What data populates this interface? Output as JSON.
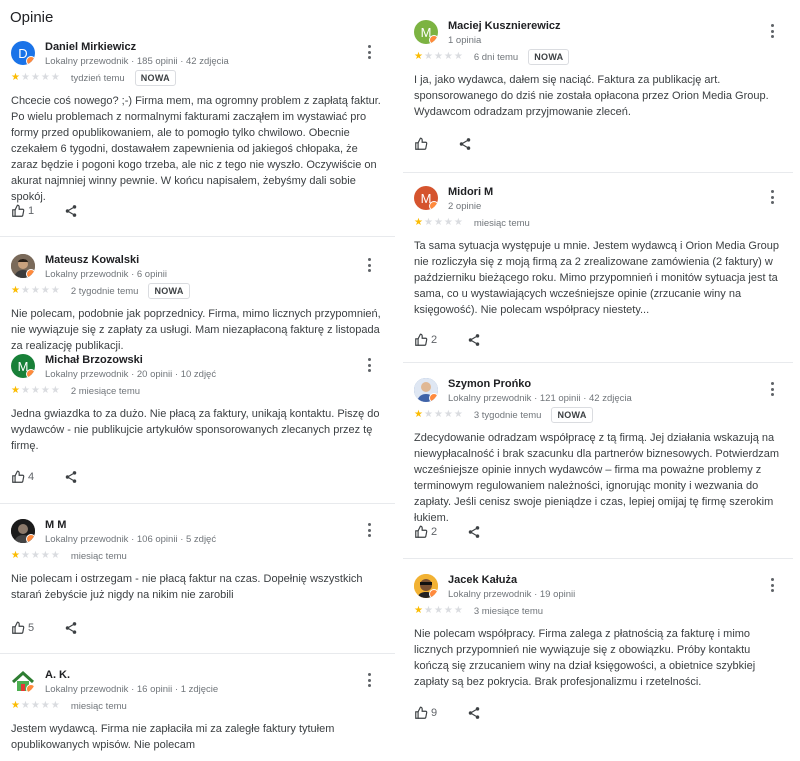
{
  "section_title": "Opinie",
  "colors": {
    "star_on": "#fbbc04",
    "star_off": "#dadce0",
    "badge": "#ff8a3d"
  },
  "reviews_left": [
    {
      "name": "Daniel Mirkiewicz",
      "meta": "Lokalny przewodnik · 185 opinii · 42 zdjęcia",
      "avatar": {
        "letter": "D",
        "color": "#1a73e8"
      },
      "rating": 1,
      "time": "tydzień temu",
      "badge": "NOWA",
      "text": "Chcecie coś nowego? ;-) Firma mem, ma ogromny problem z zapłatą faktur. Po wielu problemach z normalnymi fakturami zacząłem im wystawiać pro formy przed opublikowaniem, ale to pomogło tylko chwilowo. Obecnie czekałem 6 tygodni, dostawałem zapewnienia od jakiegoś chłopaka, że zaraz będzie i pogoni kogo trzeba, ale nic z tego nie wyszło. Oczywiście on akurat najmniej winny pewnie. W końcu napisałem, żebyśmy dali sobie spokój.",
      "likes": "1"
    },
    {
      "name": "Mateusz Kowalski",
      "meta": "Lokalny przewodnik · 6 opinii",
      "avatar": {
        "letter": "",
        "color": "#6d5a4a"
      },
      "rating": 1,
      "time": "2 tygodnie temu",
      "badge": "NOWA",
      "text": "Nie polecam, podobnie jak poprzednicy. Firma, mimo licznych przypomnień, nie wywiązuje się z zapłaty za usługi. Mam niezapłaconą fakturę z listopada za realizację publikacji.",
      "likes": ""
    },
    {
      "name": "Michał Brzozowski",
      "meta": "Lokalny przewodnik · 20 opinii · 10 zdjęć",
      "avatar": {
        "letter": "M",
        "color": "#188038"
      },
      "rating": 1,
      "time": "2 miesiące temu",
      "badge": "",
      "text": "Jedna gwiazdka to za dużo. Nie płacą za faktury, unikają kontaktu. Piszę do wydawców - nie publikujcie artykułów sponsorowanych zlecanych przez tę firmę.",
      "likes": "4"
    },
    {
      "name": "M M",
      "meta": "Lokalny przewodnik · 106 opinii · 5 zdjęć",
      "avatar": {
        "letter": "",
        "color": "#222222"
      },
      "rating": 1,
      "time": "miesiąc temu",
      "badge": "",
      "text": "Nie polecam i ostrzegam - nie płacą faktur na czas. Dopełnię wszystkich starań żebyście już nigdy na nikim nie zarobili",
      "likes": "5"
    },
    {
      "name": "A. K.",
      "meta": "Lokalny przewodnik · 16 opinii · 1 zdjęcie",
      "avatar": {
        "letter": "",
        "color": "#ffffff"
      },
      "rating": 1,
      "time": "miesiąc temu",
      "badge": "",
      "text": "Jestem wydawcą. Firma nie zapłaciła mi za zaległe faktury tytułem opublikowanych wpisów. Nie polecam",
      "likes": ""
    }
  ],
  "reviews_right": [
    {
      "name": "Maciej Kusznierewicz",
      "meta": "1 opinia",
      "avatar": {
        "letter": "M",
        "color": "#7cb342"
      },
      "rating": 1,
      "time": "6 dni temu",
      "badge": "NOWA",
      "text": "I ja, jako wydawca, dałem się naciąć. Faktura za publikację art. sponsorowanego do dziś nie została opłacona przez Orion Media Group. Wydawcom odradzam przyjmowanie zleceń.",
      "likes": ""
    },
    {
      "name": "Midori M",
      "meta": "2 opinie",
      "avatar": {
        "letter": "M",
        "color": "#d5542e"
      },
      "rating": 1,
      "time": "miesiąc temu",
      "badge": "",
      "text": "Ta sama sytuacja występuje u mnie. Jestem wydawcą i Orion Media Group nie rozliczyła się z moją firmą za 2 zrealizowane zamówienia (2 faktury) w październiku bieżącego roku. Mimo przypomnień i monitów sytuacja jest ta sama, co u wystawiających wcześniejsze opinie (zrzucanie winy na księgowość). Nie polecam współpracy niestety...",
      "likes": "2"
    },
    {
      "name": "Szymon Prońko",
      "meta": "Lokalny przewodnik · 121 opinii · 42 zdjęcia",
      "avatar": {
        "letter": "",
        "color": "#5b7fb5"
      },
      "rating": 1,
      "time": "3 tygodnie temu",
      "badge": "NOWA",
      "text": "Zdecydowanie odradzam współpracę z tą firmą. Jej działania wskazują na niewypłacalność i brak szacunku dla partnerów biznesowych. Potwierdzam wcześniejsze opinie innych wydawców – firma ma poważne problemy z terminowym regulowaniem należności, ignorując monity i wezwania do zapłaty. Jeśli cenisz swoje pieniądze i czas, lepiej omijaj tę firmę szerokim łukiem.",
      "likes": "2"
    },
    {
      "name": "Jacek Kałuża",
      "meta": "Lokalny przewodnik · 19 opinii",
      "avatar": {
        "letter": "",
        "color": "#f2b233"
      },
      "rating": 1,
      "time": "3 miesiące temu",
      "badge": "",
      "text": "Nie polecam współpracy. Firma zalega z płatnością za fakturę i mimo licznych przypomnień nie wywiązuje się z obowiązku. Próby kontaktu kończą się zrzucaniem winy na dział księgowości, a obietnice szybkiej zapłaty są bez pokrycia. Brak profesjonalizmu i rzetelności.",
      "likes": "9"
    }
  ]
}
